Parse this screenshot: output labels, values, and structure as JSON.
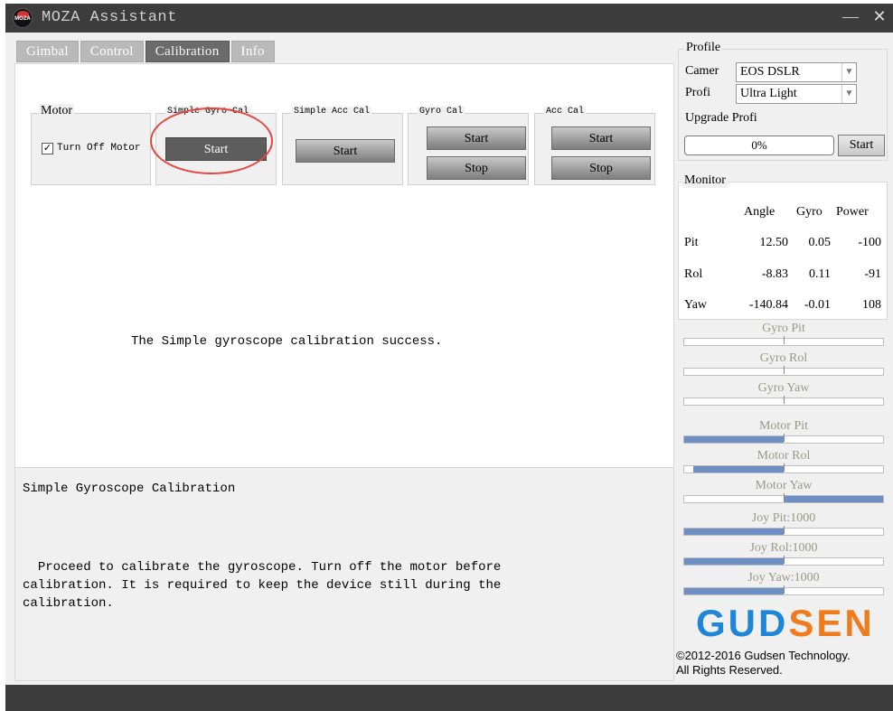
{
  "window": {
    "title": "MOZA Assistant",
    "logo_text": "MOZA",
    "minimize_glyph": "—",
    "close_glyph": "✕"
  },
  "tabs": [
    {
      "label": "Gimbal",
      "active": false
    },
    {
      "label": "Control",
      "active": false
    },
    {
      "label": "Calibration",
      "active": true
    },
    {
      "label": "Info",
      "active": false
    }
  ],
  "calibration": {
    "motor_group": {
      "label": "Motor",
      "checkbox_label": "Turn Off Motor",
      "checked": true,
      "check_glyph": "✓"
    },
    "simple_gyro": {
      "label": "Simple Gyro Cal",
      "start": "Start"
    },
    "simple_acc": {
      "label": "Simple Acc Cal",
      "start": "Start"
    },
    "gyro": {
      "label": "Gyro Cal",
      "start": "Start",
      "stop": "Stop"
    },
    "acc": {
      "label": "Acc Cal",
      "start": "Start",
      "stop": "Stop"
    },
    "status_message": "The Simple gyroscope calibration success.",
    "highlight_color": "#e8433e"
  },
  "description": {
    "title": "Simple Gyroscope Calibration",
    "body": "  Proceed to calibrate the gyroscope. Turn off the motor before\ncalibration. It is required to keep the device still during the\ncalibration."
  },
  "profile": {
    "title": "Profile",
    "camera_label": "Camer",
    "camera_value": "EOS DSLR",
    "profile_label": "Profi",
    "profile_value": "Ultra Light",
    "upgrade_label": "Upgrade Profi",
    "progress_percent": 0,
    "progress_text": "0%",
    "upgrade_button": "Start"
  },
  "monitor": {
    "title": "Monitor",
    "headers": {
      "angle": "Angle",
      "gyro": "Gyro",
      "power": "Power"
    },
    "rows": [
      {
        "name": "Pit",
        "angle": "12.50",
        "gyro": "0.05",
        "power": "-100"
      },
      {
        "name": "Rol",
        "angle": "-8.83",
        "gyro": "0.11",
        "power": "-91"
      },
      {
        "name": "Yaw",
        "angle": "-140.84",
        "gyro": "-0.01",
        "power": "108"
      }
    ]
  },
  "bars": [
    {
      "label": "Gyro Pit",
      "value": 0
    },
    {
      "label": "Gyro Rol",
      "value": 0
    },
    {
      "label": "Gyro Yaw",
      "value": 0
    },
    {
      "label": "Motor Pit",
      "value": -100
    },
    {
      "label": "Motor Rol",
      "value": -91
    },
    {
      "label": "Motor Yaw",
      "value": 100
    },
    {
      "label": "Joy Pit:1000",
      "value": -100
    },
    {
      "label": "Joy Rol:1000",
      "value": -100
    },
    {
      "label": "Joy Yaw:1000",
      "value": -100
    }
  ],
  "brand": {
    "logo_part1": "GUD",
    "logo_part2": "SEN",
    "logo_color1": "#1e86d8",
    "logo_color2": "#f07b1d",
    "copyright_line1": "©2012-2016 Gudsen Technology.",
    "copyright_line2": "All Rights Reserved."
  }
}
